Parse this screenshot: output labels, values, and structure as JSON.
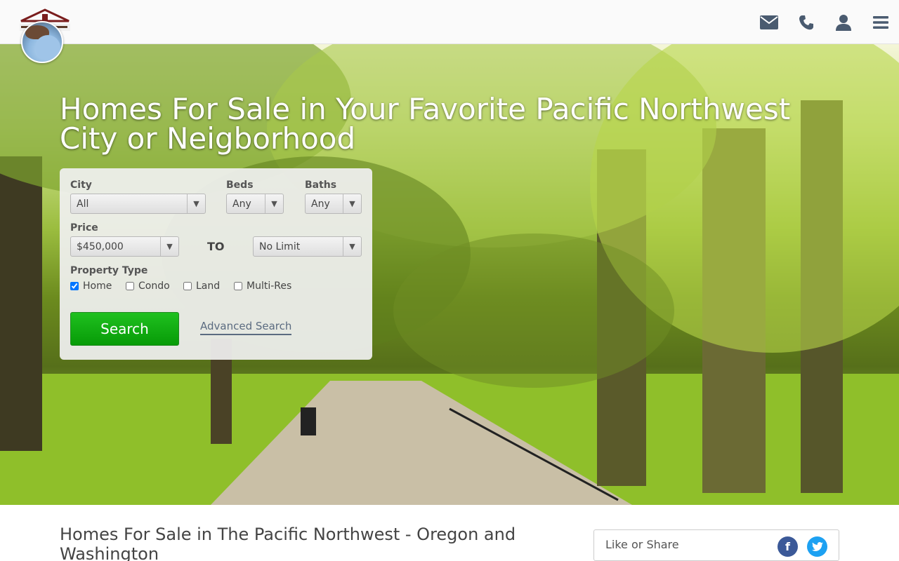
{
  "header": {
    "logo_alt": "OurHomesPDX.com",
    "icons": [
      "envelope-icon",
      "phone-icon",
      "user-icon",
      "menu-icon"
    ]
  },
  "hero": {
    "title": "Homes For Sale in Your Favorite Pacific Northwest City or Neigborhood"
  },
  "search": {
    "city_label": "City",
    "city_value": "All",
    "beds_label": "Beds",
    "beds_value": "Any",
    "baths_label": "Baths",
    "baths_value": "Any",
    "price_label": "Price",
    "price_min": "$450,000",
    "to_label": "TO",
    "price_max": "No Limit",
    "property_type_label": "Property Type",
    "types": [
      {
        "label": "Home",
        "checked": true
      },
      {
        "label": "Condo",
        "checked": false
      },
      {
        "label": "Land",
        "checked": false
      },
      {
        "label": "Multi-Res",
        "checked": false
      }
    ],
    "search_button": "Search",
    "advanced_link": "Advanced Search"
  },
  "content": {
    "heading": "Homes For Sale in The Pacific Northwest - Oregon and Washington",
    "share_label": "Like or Share",
    "facebook_glyph": "f",
    "twitter_glyph": "t"
  },
  "colors": {
    "search_button": "#10a810",
    "facebook": "#3b5998",
    "twitter": "#1da1f2",
    "nav_icon": "#4a5b70"
  }
}
